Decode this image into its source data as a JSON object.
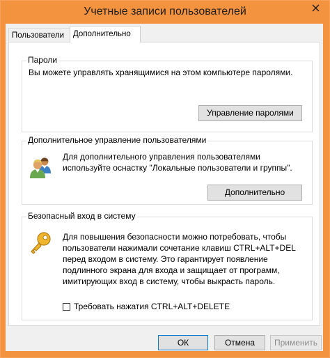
{
  "window": {
    "title": "Учетные записи пользователей"
  },
  "tabs": [
    {
      "label": "Пользователи",
      "selected": false
    },
    {
      "label": "Дополнительно",
      "selected": true
    }
  ],
  "passwords": {
    "group_title": "Пароли",
    "description": "Вы можете управлять хранящимися на этом компьютере паролями.",
    "button_label": "Управление паролями"
  },
  "advanced_users": {
    "group_title": "Дополнительное управление пользователями",
    "description_lines": [
      "Для дополнительного управления пользователями",
      "используйте оснастку \"Локальные пользователи и группы\"."
    ],
    "button_label": "Дополнительно",
    "icon": "users-icon"
  },
  "secure_logon": {
    "group_title": "Безопасный вход в систему",
    "description_lines": [
      "Для повышения безопасности можно потребовать, чтобы",
      "пользователи нажимали сочетание клавиш CTRL+ALT+DEL",
      "перед входом в систему. Это гарантирует появление",
      "подлинного экрана для входа и защищает от программ,",
      "имитирующих вход в систему, чтобы выкрасть пароль."
    ],
    "checkbox_label": "Требовать нажатия CTRL+ALT+DELETE",
    "checkbox_checked": false,
    "icon": "key-icon"
  },
  "footer": {
    "ok_label": "ОК",
    "cancel_label": "Отмена",
    "apply_label": "Применить"
  },
  "colors": {
    "titlebar": "#f3923f",
    "accent": "#0078d7"
  }
}
